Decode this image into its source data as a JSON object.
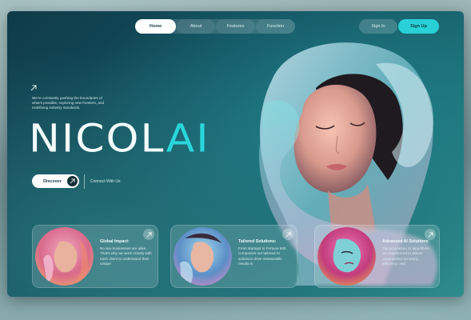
{
  "nav": {
    "items": [
      {
        "label": "Home"
      },
      {
        "label": "About"
      },
      {
        "label": "Features"
      },
      {
        "label": "Function"
      }
    ],
    "sign_in": "Sign In",
    "sign_up": "Sign Up"
  },
  "hero": {
    "tagline": "We're constantly pushing the boundaries of what's possible, exploring new frontiers, and redefining industry standards.",
    "logo_main": "NICOL",
    "logo_accent": "AI",
    "discover_label": "Discover",
    "connect_label": "Connect With Us"
  },
  "cards": [
    {
      "title": "Global Impact:",
      "desc": "No two businesses are alike. That's why we work closely with each client to understand their unique"
    },
    {
      "title": "Tailored Solutions:",
      "desc": "From startups to Fortune 500 companies our tailored AI solutions drive measurable results in"
    },
    {
      "title": "Advanced AI Solutions:",
      "desc": "Our proprietary AI algorithms are engineered to deliver unparalleled accuracy, efficiency, and"
    }
  ],
  "colors": {
    "accent": "#2ad6dc",
    "background": "#12505e"
  },
  "icons": {
    "arrow": "arrow-up-right-icon"
  }
}
